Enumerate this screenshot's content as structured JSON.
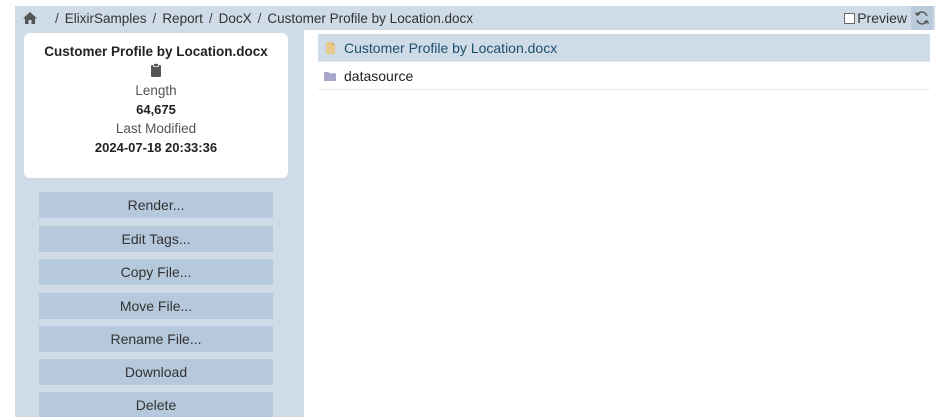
{
  "breadcrumb": {
    "separator": "/",
    "items": [
      "ElixirSamples",
      "Report",
      "DocX",
      "Customer Profile by Location.docx"
    ]
  },
  "toolbar": {
    "preview_label": "Preview",
    "preview_checked": false
  },
  "info": {
    "filename": "Customer Profile by Location.docx",
    "length_label": "Length",
    "length_value": "64,675",
    "modified_label": "Last Modified",
    "modified_value": "2024-07-18 20:33:36"
  },
  "actions": [
    "Render...",
    "Edit Tags...",
    "Copy File...",
    "Move File...",
    "Rename File...",
    "Download",
    "Delete"
  ],
  "files": [
    {
      "name": "Customer Profile by Location.docx",
      "icon": "document-icon",
      "selected": true
    },
    {
      "name": "datasource",
      "icon": "folder-icon",
      "selected": false
    }
  ],
  "colors": {
    "panel": "#cfdbe7",
    "button": "#b6c8db",
    "doc_icon": "#e7c98a",
    "folder_icon": "#a9a6cb"
  }
}
